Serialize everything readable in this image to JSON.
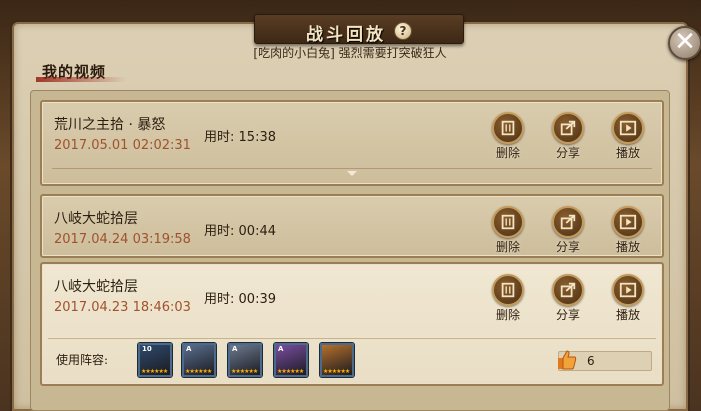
{
  "window": {
    "title": "战斗回放",
    "subtitle": "[吃肉的小白兔] 强烈需要打突破狂人",
    "help_label": "?",
    "close_label": "✕"
  },
  "section": {
    "label": "我的视频"
  },
  "actions": {
    "delete": "删除",
    "share": "分享",
    "play": "播放"
  },
  "duration_prefix": "用时:",
  "videos": [
    {
      "title": "荒川之主拾 · 暴怒",
      "date": "2017.05.01 02:02:31",
      "duration": "15:38",
      "expanded": false
    },
    {
      "title": "八岐大蛇拾层",
      "date": "2017.04.24 03:19:58",
      "duration": "00:44",
      "expanded": false
    },
    {
      "title": "八岐大蛇拾层",
      "date": "2017.04.23 18:46:03",
      "duration": "00:39",
      "expanded": true
    }
  ],
  "lineup": {
    "label": "使用阵容:",
    "shikigami": [
      {
        "icon": "shikigami-portrait-dark-icon",
        "level": "10",
        "stars": 6,
        "color": "#2e4a6b"
      },
      {
        "icon": "shikigami-portrait-mask-icon",
        "level": "A",
        "stars": 6,
        "color": "#5a6f8f"
      },
      {
        "icon": "shikigami-portrait-white-icon",
        "level": "A",
        "stars": 6,
        "color": "#6b7a8e"
      },
      {
        "icon": "shikigami-portrait-fox-icon",
        "level": "A",
        "stars": 6,
        "color": "#7a4da0"
      },
      {
        "icon": "shikigami-portrait-flame-icon",
        "level": "",
        "stars": 6,
        "color": "#b5702a"
      }
    ],
    "likes": "6"
  },
  "colors": {
    "date": "#a0522d",
    "accent_ribbon": "#961e14"
  }
}
